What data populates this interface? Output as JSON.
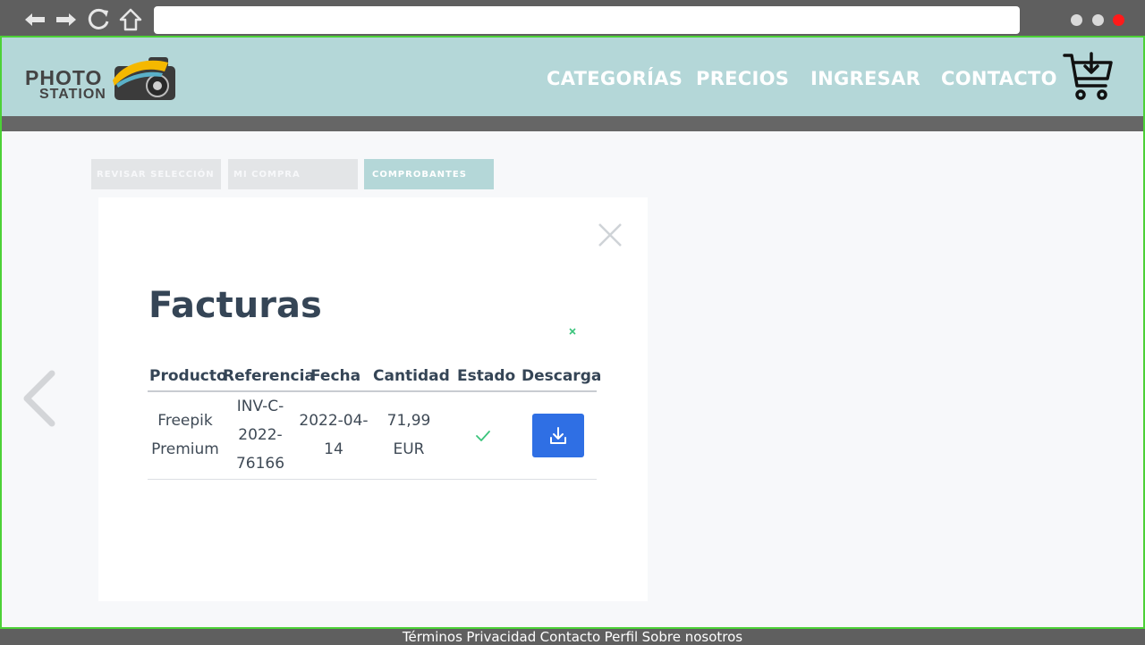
{
  "browser": {
    "back_icon": "back-arrow-icon",
    "forward_icon": "forward-arrow-icon",
    "reload_icon": "reload-icon",
    "home_icon": "home-icon",
    "url": "",
    "window_dots": [
      "#d9d9d9",
      "#d9d9d9",
      "#ff1a1a"
    ]
  },
  "header": {
    "logo_line1": "PHOTO",
    "logo_line2": "STATION",
    "menu": [
      "CATEGORÍAS",
      "PRECIOS",
      "INGRESAR",
      "CONTACTO"
    ],
    "cart_icon": "cart-download-icon"
  },
  "steps": [
    {
      "label": "REVISAR SELECCIÓN",
      "active": false
    },
    {
      "label": "MI COMPRA",
      "active": false
    },
    {
      "label": "COMPROBANTES",
      "active": true
    }
  ],
  "modal": {
    "title": "Facturas",
    "table": {
      "headers": [
        "Producto",
        "Referencia",
        "Fecha",
        "Cantidad",
        "Estado",
        "Descarga"
      ],
      "rows": [
        {
          "producto": [
            "Freepik",
            "Premium"
          ],
          "referencia": [
            "INV-C-",
            "2022-",
            "76166"
          ],
          "fecha": [
            "2022-04-",
            "14"
          ],
          "cantidad": [
            "71,99",
            "EUR"
          ],
          "estado": "check-icon",
          "descarga": "download-icon"
        }
      ]
    }
  },
  "footer": {
    "links": [
      "Términos",
      "Privacidad",
      "Contacto",
      "Perfil",
      "Sobre nosotros"
    ]
  },
  "colors": {
    "header_bg": "#b4d7d8",
    "band": "#666666",
    "title": "#354556",
    "button": "#2f6fe4",
    "check": "#3bc47c",
    "frame_border": "#4cd137"
  }
}
